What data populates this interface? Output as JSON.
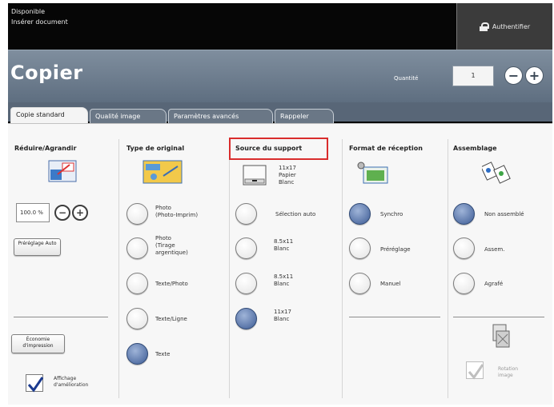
{
  "status": {
    "line1": "Disponible",
    "line2": "Insérer document",
    "auth_label": "Authentifier"
  },
  "header": {
    "title": "Copier",
    "quantity_label": "Quantité",
    "quantity_value": "1",
    "minus_label": "−",
    "plus_label": "+"
  },
  "tabs": [
    {
      "label": "Copie standard"
    },
    {
      "label": "Qualité image"
    },
    {
      "label": "Paramètres avancés"
    },
    {
      "label": "Rappeler"
    }
  ],
  "reduce": {
    "title": "Réduire/Agrandir",
    "value": "100.0 %",
    "minus_label": "−",
    "plus_label": "+",
    "preset_label": "Préréglage\nAuto",
    "bottom_button_label": "Économie\nd'impression",
    "checkbox_label": "Affichage\nd'amélioration",
    "checkbox_checked": true
  },
  "original_type": {
    "title": "Type de original",
    "options": [
      {
        "label": "Photo\n(Photo-Imprim)",
        "selected": false
      },
      {
        "label": "Photo\n(Tirage\nargentique)",
        "selected": false
      },
      {
        "label": "Texte/Photo",
        "selected": false
      },
      {
        "label": "Texte/Ligne",
        "selected": false
      },
      {
        "label": "Texte",
        "selected": true
      }
    ]
  },
  "paper_source": {
    "title": "Source du support",
    "top_item": "11x17\nPapier\nBlanc",
    "options": [
      {
        "label": "Sélection auto",
        "selected": false
      },
      {
        "label": "8.5x11\nBlanc",
        "selected": false
      },
      {
        "label": "8.5x11\nBlanc",
        "selected": false
      },
      {
        "label": "11x17\nBlanc",
        "selected": true
      }
    ]
  },
  "output_format": {
    "title": "Format de réception",
    "options": [
      {
        "label": "Synchro",
        "selected": true
      },
      {
        "label": "Préréglage",
        "selected": false
      },
      {
        "label": "Manuel",
        "selected": false
      }
    ]
  },
  "collation": {
    "title": "Assemblage",
    "options": [
      {
        "label": "Non assemblé",
        "selected": true
      },
      {
        "label": "Assem.",
        "selected": false
      },
      {
        "label": "Agrafé",
        "selected": false
      }
    ],
    "checkbox_label": "Rotation\nimage",
    "checkbox_checked": true
  },
  "colors": {
    "radio_selected": "#3c5b95",
    "highlight": "#d92c2c",
    "header_bg": "#6f7e8f"
  }
}
